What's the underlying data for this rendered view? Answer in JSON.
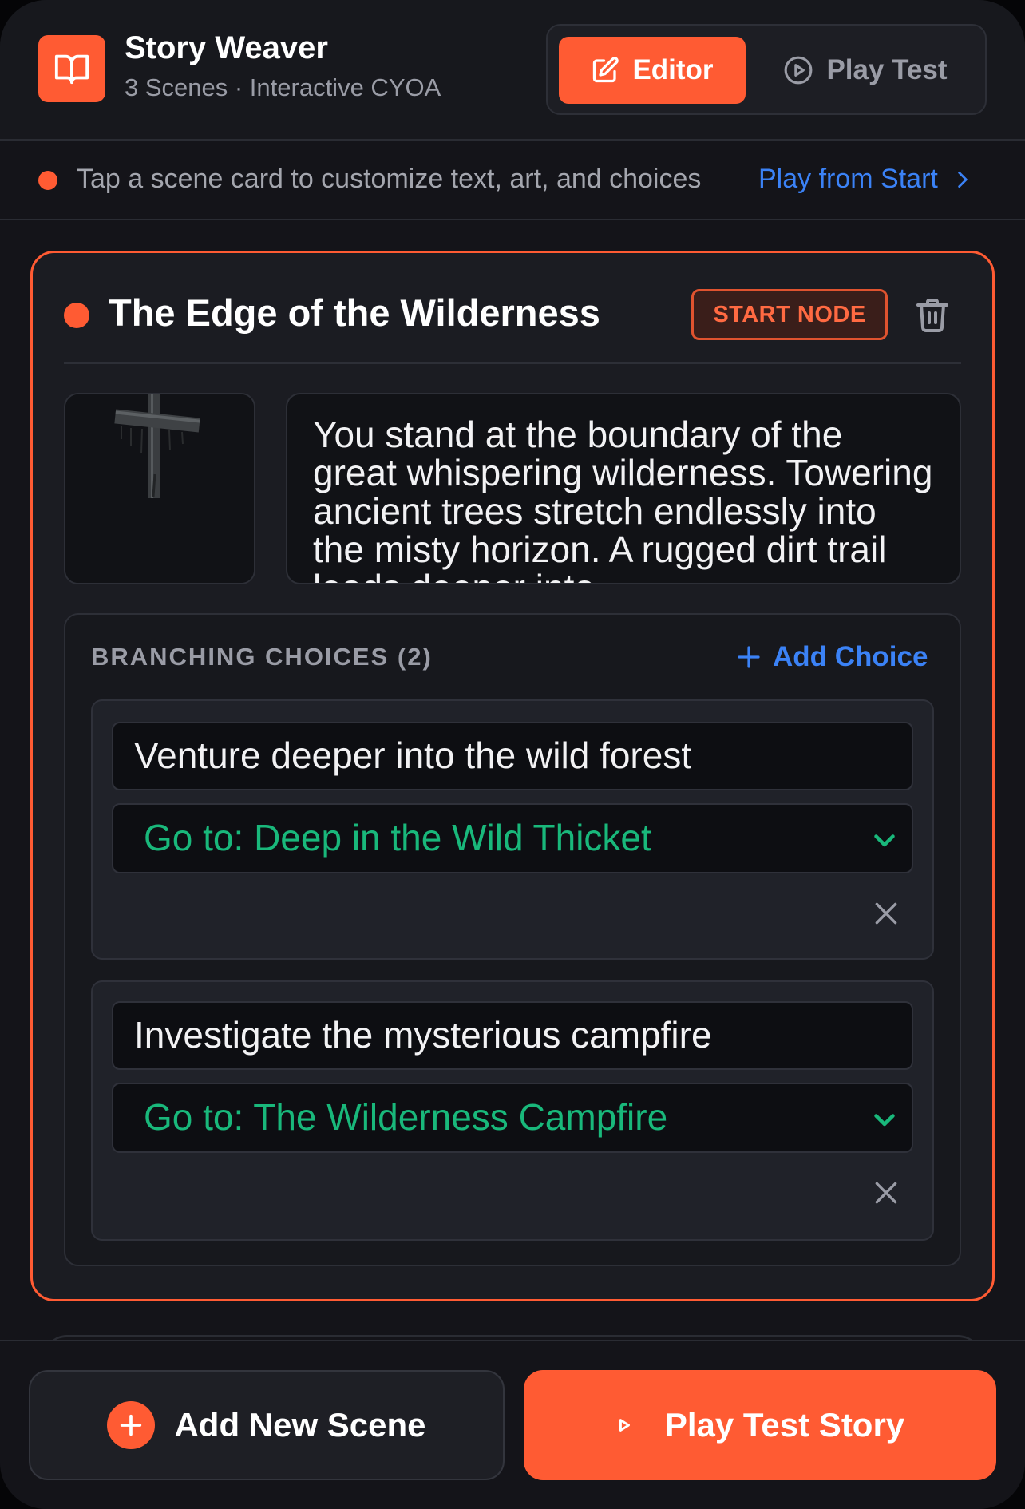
{
  "header": {
    "title": "Story Weaver",
    "subtitle": "3 Scenes · Interactive CYOA",
    "modes": {
      "editor_label": "Editor",
      "playtest_label": "Play Test",
      "active": "Editor"
    }
  },
  "hint": {
    "text": "Tap a scene card to customize text, art, and choices",
    "link_label": "Play from Start"
  },
  "scene": {
    "title": "The Edge of the Wilderness",
    "badge": "START NODE",
    "body": "You stand at the boundary of the great whispering wilderness. Towering ancient trees stretch endlessly into the misty horizon. A rugged dirt trail leads deeper into",
    "art_icon": "wooden-cross-image",
    "choices_heading": "BRANCHING CHOICES (2)",
    "add_choice_label": "Add Choice",
    "choices": [
      {
        "text": "Venture deeper into the wild forest",
        "target": "Go to: Deep in the Wild Thicket"
      },
      {
        "text": "Investigate the mysterious campfire",
        "target": "Go to: The Wilderness Campfire"
      }
    ]
  },
  "footer": {
    "add_scene_label": "Add New Scene",
    "play_story_label": "Play Test Story"
  },
  "colors": {
    "accent": "#ff5b33",
    "link": "#3b82f6",
    "target_green": "#19b87b",
    "background": "#141419"
  }
}
